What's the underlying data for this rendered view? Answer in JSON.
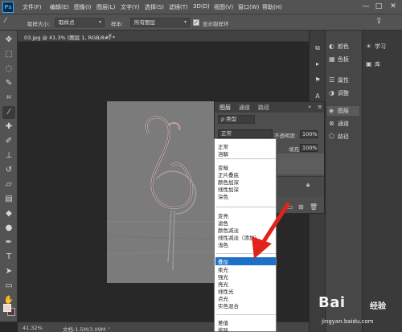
{
  "menubar": {
    "logo": "Ps",
    "items": [
      "文件(F)",
      "编辑(E)",
      "图像(I)",
      "图层(L)",
      "文字(Y)",
      "选择(S)",
      "滤镜(T)",
      "3D(D)",
      "视图(V)",
      "窗口(W)",
      "帮助(H)"
    ],
    "minimize": "—",
    "maximize": "□",
    "close": "✕"
  },
  "optbar": {
    "sample_size_label": "取样大小:",
    "sample_size_value": "取样点",
    "sample_label": "样本:",
    "sample_value": "所有图层",
    "show_ring_label": "显示取样环"
  },
  "doc": {
    "tab_label": "03.jpg @ 41.3% (图层 1, RGB/8#) *",
    "tab_close": "×"
  },
  "status": {
    "zoom": "41.32%",
    "doc_info": "文档:1.5M/3.09M"
  },
  "dock": {
    "panel_items": [
      "颜色",
      "色板",
      "属性",
      "调整",
      "图层",
      "通道",
      "路径"
    ],
    "far_items": [
      "学习",
      "库"
    ]
  },
  "layers_panel": {
    "tabs": [
      "图层",
      "通道",
      "路径"
    ],
    "kind_filter": "ρ 类型",
    "blend_mode": "正常",
    "opacity_label": "不透明度:",
    "opacity_value": "100%",
    "fill_label": "填充:",
    "fill_value": "100%"
  },
  "blend_menu": {
    "group1": [
      "正常",
      "溶解"
    ],
    "group2": [
      "变暗",
      "正片叠底",
      "颜色加深",
      "线性加深",
      "深色"
    ],
    "group3": [
      "变亮",
      "滤色",
      "颜色减淡",
      "线性减淡（添加）",
      "浅色"
    ],
    "group4": [
      "叠加",
      "柔光",
      "强光",
      "亮光",
      "线性光",
      "点光",
      "实色混合"
    ],
    "group5": [
      "差值",
      "排除"
    ],
    "selected": "叠加"
  },
  "watermark": {
    "brand": "Bai",
    "brand_suffix": "经验",
    "url": "jingyan.baidu.com"
  },
  "colors": {
    "ui_dark": "#535353",
    "canvas_bg": "#282828",
    "selected_blue": "#1e6fc6",
    "arrow_red": "#e0231c"
  }
}
